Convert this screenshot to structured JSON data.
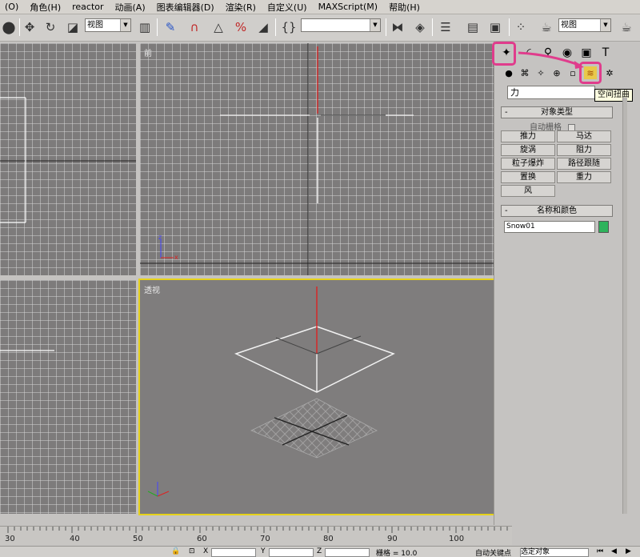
{
  "menu": [
    "(O)",
    "角色(H)",
    "reactor",
    "动画(A)",
    "图表编辑器(D)",
    "渲染(R)",
    "自定义(U)",
    "MAXScript(M)",
    "帮助(H)"
  ],
  "toolbar": {
    "view_combo": "视图",
    "selection_set": "",
    "view_combo_right": "视图"
  },
  "viewports": {
    "front_label": "前",
    "perspective_label": "透视"
  },
  "command_panel": {
    "category_value": "力",
    "tooltip": "空间扭曲",
    "object_type": {
      "title": "对象类型",
      "autogrid_label": "自动栅格",
      "buttons": [
        "推力",
        "马达",
        "旋涡",
        "阻力",
        "粒子爆炸",
        "路径跟随",
        "置换",
        "重力",
        "风"
      ]
    },
    "name_color": {
      "title": "名称和颜色",
      "name_value": "Snow01",
      "color": "#2fb35c"
    }
  },
  "timeline": {
    "ticks": [
      "30",
      "40",
      "50",
      "60",
      "70",
      "80",
      "90",
      "100"
    ]
  },
  "status": {
    "x_label": "X",
    "y_label": "Y",
    "z_label": "Z",
    "grid_text": "栅格 = 10.0",
    "autokey_label": "自动关键点",
    "selected_combo": "选定对象"
  },
  "colors": {
    "highlight": "#e03c8c",
    "active_viewport": "#e6d21a",
    "swatch": "#2fb35c"
  }
}
